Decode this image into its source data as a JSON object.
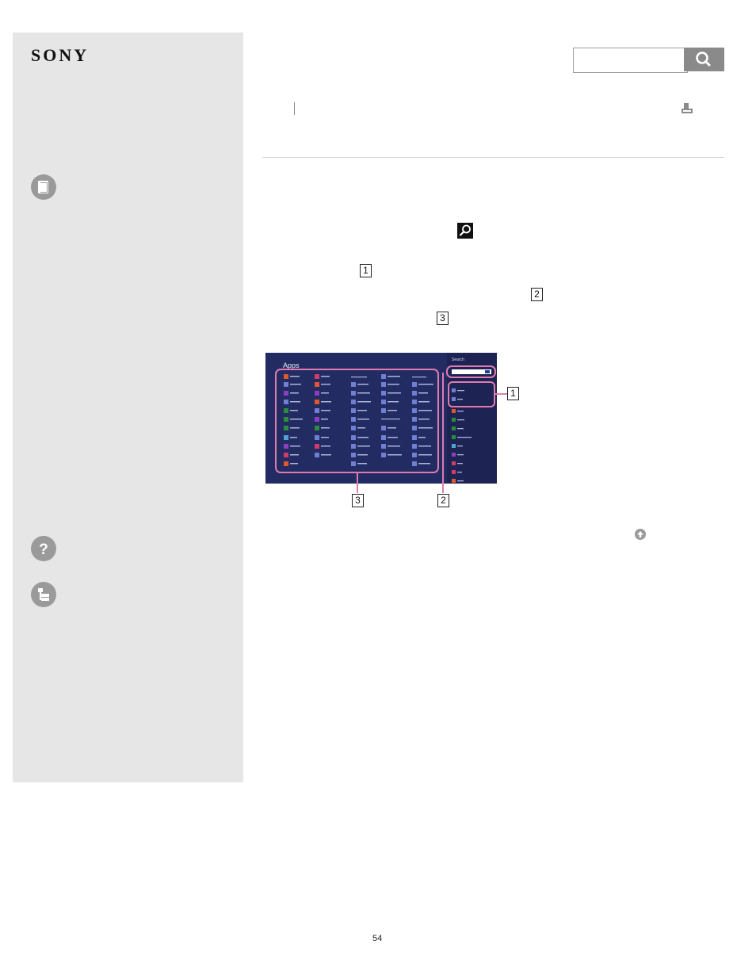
{
  "brand": {
    "logo": "SONY"
  },
  "header": {
    "search_placeholder": ""
  },
  "figure": {
    "apps_title": "Apps",
    "search_label": "Search",
    "callouts": [
      "1",
      "2",
      "3"
    ]
  },
  "body": {
    "step_callouts": [
      "1",
      "2",
      "3"
    ]
  },
  "footer": {
    "page_number": "54"
  },
  "colors": {
    "sidebar": "#e6e6e6",
    "screen": "#232b63",
    "highlight": "#e07bb0"
  }
}
